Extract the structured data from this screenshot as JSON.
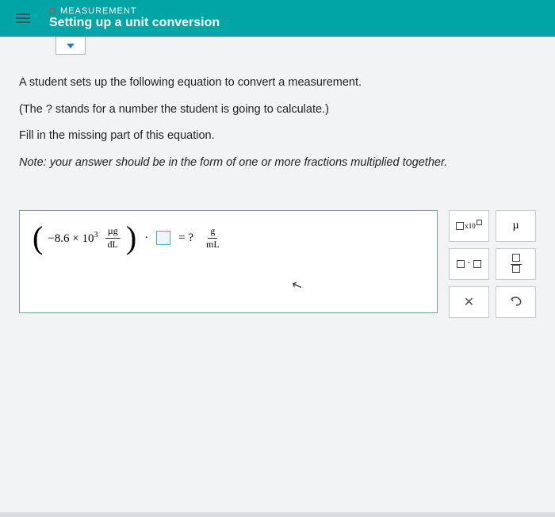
{
  "header": {
    "breadcrumb": "MEASUREMENT",
    "title": "Setting up a unit conversion"
  },
  "question": {
    "l1": "A student sets up the following equation to convert a measurement.",
    "l2": "(The ? stands for a number the student is going to calculate.)",
    "l3": "Fill in the missing part of this equation.",
    "noteLabel": "Note:",
    "noteText": " your answer should be in the form of one or more fractions multiplied together."
  },
  "equation": {
    "coef": "−8.6 × 10",
    "exp": "3",
    "leftFrac": {
      "num": "µg",
      "den": "dL"
    },
    "dot": "·",
    "equals": "= ?",
    "rightFrac": {
      "num": "g",
      "den": "mL"
    }
  },
  "tools": {
    "sciSub": "x10",
    "mu": "µ",
    "dotOp": "·",
    "clear": "✕"
  }
}
